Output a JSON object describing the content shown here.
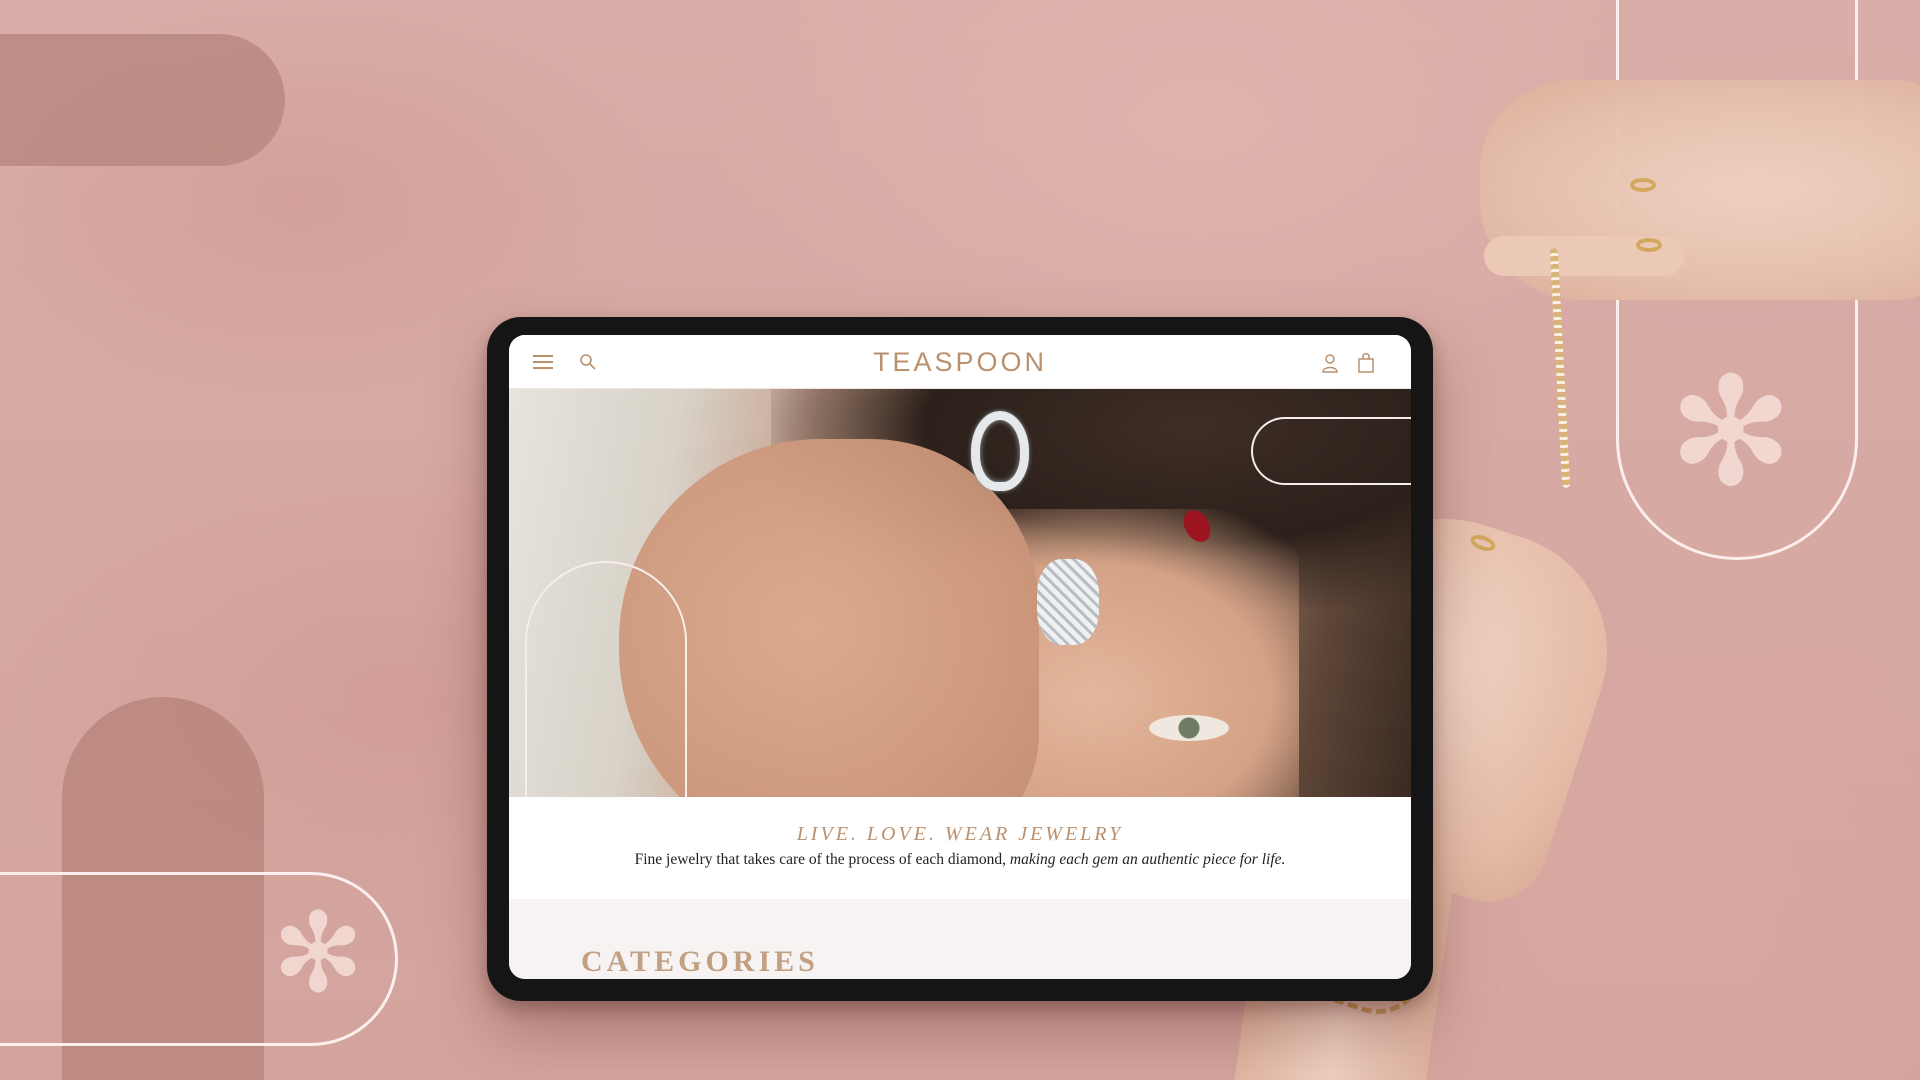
{
  "site": {
    "brand": "TEASPOON",
    "header_icons": {
      "left": [
        "hamburger-menu-icon",
        "search-icon"
      ],
      "right": [
        "account-icon",
        "shopping-bag-icon"
      ]
    },
    "hero": {
      "tagline": "LIVE. LOVE. WEAR JEWELRY",
      "subtext_plain": "Fine jewelry that takes care of the process of each diamond, ",
      "subtext_italic": "making each gem an authentic piece for life."
    },
    "categories": {
      "title": "CATEGORIES"
    }
  },
  "colors": {
    "background": "#d7aaa4",
    "accent_gold": "#b9916e",
    "tablet_bezel": "#151515",
    "outline": "#fbeeec"
  }
}
